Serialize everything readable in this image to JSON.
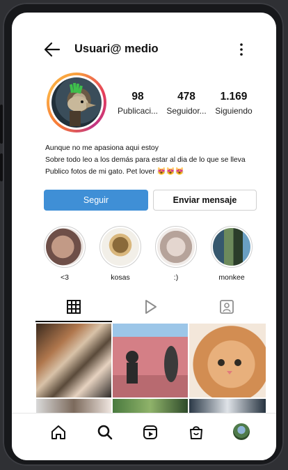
{
  "header": {
    "username": "Usuari@ medio",
    "back_icon": "arrow-left-icon",
    "more_icon": "vertical-dots-icon"
  },
  "profile": {
    "stats": [
      {
        "value": "98",
        "label": "Publicaci..."
      },
      {
        "value": "478",
        "label": "Seguidor..."
      },
      {
        "value": "1.169",
        "label": "Siguiendo"
      }
    ],
    "bio": [
      "Aunque no me apasiona aqui estoy",
      "Sobre todo leo a los demás para estar al dia de lo que se lleva",
      "Publico fotos de mi gato. Pet lover 😻😻😻"
    ]
  },
  "actions": {
    "follow_label": "Seguir",
    "message_label": "Enviar mensaje"
  },
  "highlights": [
    {
      "label": "<3"
    },
    {
      "label": "kosas"
    },
    {
      "label": ":)"
    },
    {
      "label": "monkee"
    }
  ],
  "tabs": [
    "grid-icon",
    "reels-icon",
    "tagged-icon"
  ],
  "bottom_nav": [
    "home-icon",
    "search-icon",
    "reels-icon",
    "shop-icon",
    "profile-avatar"
  ],
  "colors": {
    "follow_button": "#3f8fd6",
    "story_ring": "#e43d5b"
  }
}
